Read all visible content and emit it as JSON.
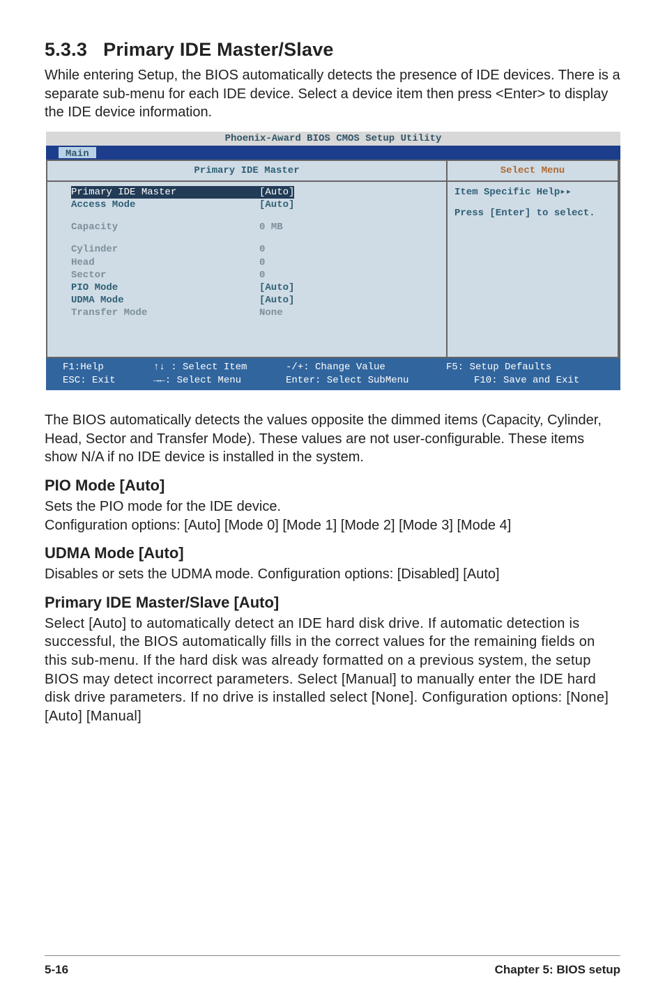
{
  "section": {
    "number": "5.3.3",
    "title": "Primary IDE Master/Slave"
  },
  "intro": "While entering Setup, the BIOS automatically detects the presence of IDE devices. There is a separate sub-menu for each IDE device. Select a device item then press <Enter> to display the IDE device information.",
  "bios": {
    "title": "Phoenix-Award BIOS CMOS Setup Utility",
    "tab": "Main",
    "left_header": "Primary IDE Master",
    "right_header": "Select Menu",
    "help_line1": "Item Specific Help▸▸",
    "help_line2": "Press [Enter] to select.",
    "rows": [
      {
        "label": "Primary IDE Master",
        "value": "[Auto]",
        "style": "high"
      },
      {
        "label": "Access Mode",
        "value": "[Auto]",
        "style": "norm"
      },
      {
        "label": "",
        "value": "",
        "style": "spacer"
      },
      {
        "label": "Capacity",
        "value": "0 MB",
        "style": "dim"
      },
      {
        "label": "",
        "value": "",
        "style": "spacer"
      },
      {
        "label": "Cylinder",
        "value": "0",
        "style": "dim"
      },
      {
        "label": "Head",
        "value": "0",
        "style": "dim"
      },
      {
        "label": "Sector",
        "value": "0",
        "style": "dim"
      },
      {
        "label": "PIO Mode",
        "value": "[Auto]",
        "style": "norm"
      },
      {
        "label": "UDMA Mode",
        "value": "[Auto]",
        "style": "norm"
      },
      {
        "label": "Transfer Mode",
        "value": "None",
        "style": "dim"
      }
    ],
    "footer": {
      "r1c1": "F1:Help",
      "r1c2": "↑↓ : Select Item",
      "r1c3": "-/+: Change Value",
      "r1c4": "F5: Setup Defaults",
      "r2c1": "ESC: Exit",
      "r2c2": "→←: Select Menu",
      "r2c3": "Enter: Select SubMenu",
      "r2c4": "F10: Save and Exit"
    }
  },
  "para2": "The BIOS automatically detects the values opposite the dimmed items (Capacity, Cylinder,  Head, Sector and Transfer Mode). These values are not user-configurable. These items show N/A if no IDE device is installed in the system.",
  "pio": {
    "heading": "PIO Mode [Auto]",
    "line1": "Sets the PIO mode for the IDE device.",
    "line2": "Configuration options: [Auto] [Mode 0] [Mode 1] [Mode 2] [Mode 3] [Mode 4]"
  },
  "udma": {
    "heading": "UDMA Mode [Auto]",
    "line1": "Disables or sets the UDMA mode. Configuration options: [Disabled] [Auto]"
  },
  "pms": {
    "heading": "Primary IDE Master/Slave [Auto]",
    "body": "Select [Auto] to automatically detect an IDE hard disk drive. If automatic detection is successful, the BIOS automatically fills in the correct values for the remaining fields on this sub-menu. If the hard disk was already formatted on a previous system, the setup BIOS may detect incorrect parameters. Select [Manual] to manually enter the IDE hard disk drive parameters. If no drive is installed select [None]. Configuration options: [None] [Auto] [Manual]"
  },
  "footer": {
    "page": "5-16",
    "chapter": "Chapter 5: BIOS setup"
  }
}
